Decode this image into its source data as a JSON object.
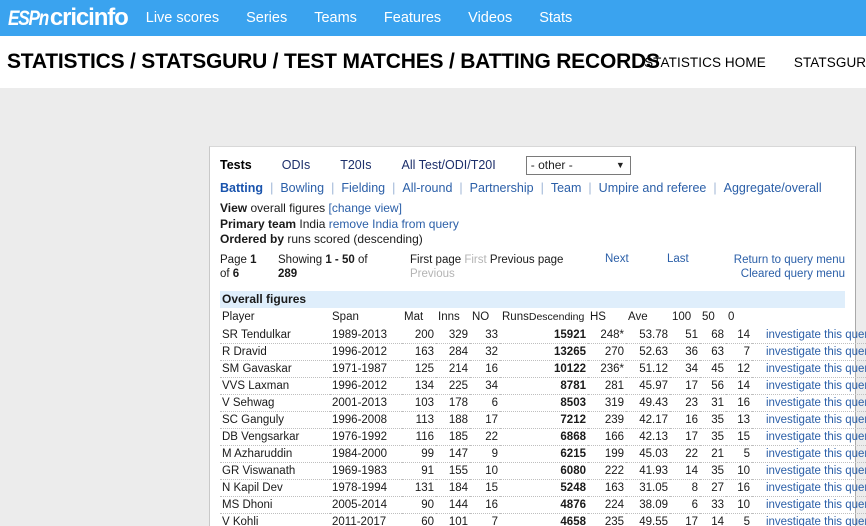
{
  "topbar": {
    "logo_espn": "ESPn",
    "logo_cricinfo": "cricinfo",
    "nav": [
      {
        "label": "Live scores"
      },
      {
        "label": "Series"
      },
      {
        "label": "Teams"
      },
      {
        "label": "Features"
      },
      {
        "label": "Videos"
      },
      {
        "label": "Stats"
      }
    ],
    "accent_color": "#3aa3ef"
  },
  "title": {
    "heading": "STATISTICS / STATSGURU / TEST MATCHES / BATTING RECORDS",
    "nav": [
      {
        "label": "STATISTICS HOME"
      },
      {
        "label": "STATSGURU"
      }
    ]
  },
  "format_tabs": [
    {
      "label": "Tests",
      "active": true
    },
    {
      "label": "ODIs",
      "active": false
    },
    {
      "label": "T20Is",
      "active": false
    },
    {
      "label": "All Test/ODI/T20I",
      "active": false
    }
  ],
  "other_select": {
    "value": "- other -",
    "arrow": "chevron-down-icon"
  },
  "sub_links": [
    {
      "label": "Batting",
      "active": true
    },
    {
      "label": "Bowling",
      "active": false
    },
    {
      "label": "Fielding",
      "active": false
    },
    {
      "label": "All-round",
      "active": false
    },
    {
      "label": "Partnership",
      "active": false
    },
    {
      "label": "Team",
      "active": false
    },
    {
      "label": "Umpire and referee",
      "active": false
    },
    {
      "label": "Aggregate/overall",
      "active": false
    }
  ],
  "query_info": {
    "view_label": "View",
    "view_value": "overall figures",
    "view_change": "[change view]",
    "team_label": "Primary team",
    "team_value": "India",
    "team_remove": "remove India from query",
    "order_label": "Ordered by",
    "order_value": "runs scored (descending)"
  },
  "pager": {
    "page_prefix": "Page",
    "page_number": "1",
    "page_of": "of",
    "page_total": "6",
    "showing_prefix": "Showing",
    "showing_range": "1 - 50",
    "showing_of": "of",
    "showing_total": "289",
    "first_page": "First page",
    "first": "First",
    "previous_page": "Previous page",
    "previous": "Previous",
    "next": "Next",
    "last": "Last",
    "return_to_query": "Return to query menu",
    "cleared_query": "Cleared query menu"
  },
  "table": {
    "caption": "Overall figures",
    "columns": {
      "player": "Player",
      "span": "Span",
      "mat": "Mat",
      "inns": "Inns",
      "no": "NO",
      "runs": "Runs",
      "runs_sub": "Descending",
      "hs": "HS",
      "ave": "Ave",
      "hundreds": "100",
      "fifties": "50",
      "ducks": "0"
    },
    "action_label": "investigate this query",
    "rows": [
      {
        "player": "SR Tendulkar",
        "span": "1989-2013",
        "mat": "200",
        "inns": "329",
        "no": "33",
        "runs": "15921",
        "hs": "248*",
        "ave": "53.78",
        "hundreds": "51",
        "fifties": "68",
        "ducks": "14"
      },
      {
        "player": "R Dravid",
        "span": "1996-2012",
        "mat": "163",
        "inns": "284",
        "no": "32",
        "runs": "13265",
        "hs": "270",
        "ave": "52.63",
        "hundreds": "36",
        "fifties": "63",
        "ducks": "7"
      },
      {
        "player": "SM Gavaskar",
        "span": "1971-1987",
        "mat": "125",
        "inns": "214",
        "no": "16",
        "runs": "10122",
        "hs": "236*",
        "ave": "51.12",
        "hundreds": "34",
        "fifties": "45",
        "ducks": "12"
      },
      {
        "player": "VVS Laxman",
        "span": "1996-2012",
        "mat": "134",
        "inns": "225",
        "no": "34",
        "runs": "8781",
        "hs": "281",
        "ave": "45.97",
        "hundreds": "17",
        "fifties": "56",
        "ducks": "14"
      },
      {
        "player": "V Sehwag",
        "span": "2001-2013",
        "mat": "103",
        "inns": "178",
        "no": "6",
        "runs": "8503",
        "hs": "319",
        "ave": "49.43",
        "hundreds": "23",
        "fifties": "31",
        "ducks": "16"
      },
      {
        "player": "SC Ganguly",
        "span": "1996-2008",
        "mat": "113",
        "inns": "188",
        "no": "17",
        "runs": "7212",
        "hs": "239",
        "ave": "42.17",
        "hundreds": "16",
        "fifties": "35",
        "ducks": "13"
      },
      {
        "player": "DB Vengsarkar",
        "span": "1976-1992",
        "mat": "116",
        "inns": "185",
        "no": "22",
        "runs": "6868",
        "hs": "166",
        "ave": "42.13",
        "hundreds": "17",
        "fifties": "35",
        "ducks": "15"
      },
      {
        "player": "M Azharuddin",
        "span": "1984-2000",
        "mat": "99",
        "inns": "147",
        "no": "9",
        "runs": "6215",
        "hs": "199",
        "ave": "45.03",
        "hundreds": "22",
        "fifties": "21",
        "ducks": "5"
      },
      {
        "player": "GR Viswanath",
        "span": "1969-1983",
        "mat": "91",
        "inns": "155",
        "no": "10",
        "runs": "6080",
        "hs": "222",
        "ave": "41.93",
        "hundreds": "14",
        "fifties": "35",
        "ducks": "10"
      },
      {
        "player": "N Kapil Dev",
        "span": "1978-1994",
        "mat": "131",
        "inns": "184",
        "no": "15",
        "runs": "5248",
        "hs": "163",
        "ave": "31.05",
        "hundreds": "8",
        "fifties": "27",
        "ducks": "16"
      },
      {
        "player": "MS Dhoni",
        "span": "2005-2014",
        "mat": "90",
        "inns": "144",
        "no": "16",
        "runs": "4876",
        "hs": "224",
        "ave": "38.09",
        "hundreds": "6",
        "fifties": "33",
        "ducks": "10"
      },
      {
        "player": "V Kohli",
        "span": "2011-2017",
        "mat": "60",
        "inns": "101",
        "no": "7",
        "runs": "4658",
        "hs": "235",
        "ave": "49.55",
        "hundreds": "17",
        "fifties": "14",
        "ducks": "5"
      }
    ]
  }
}
